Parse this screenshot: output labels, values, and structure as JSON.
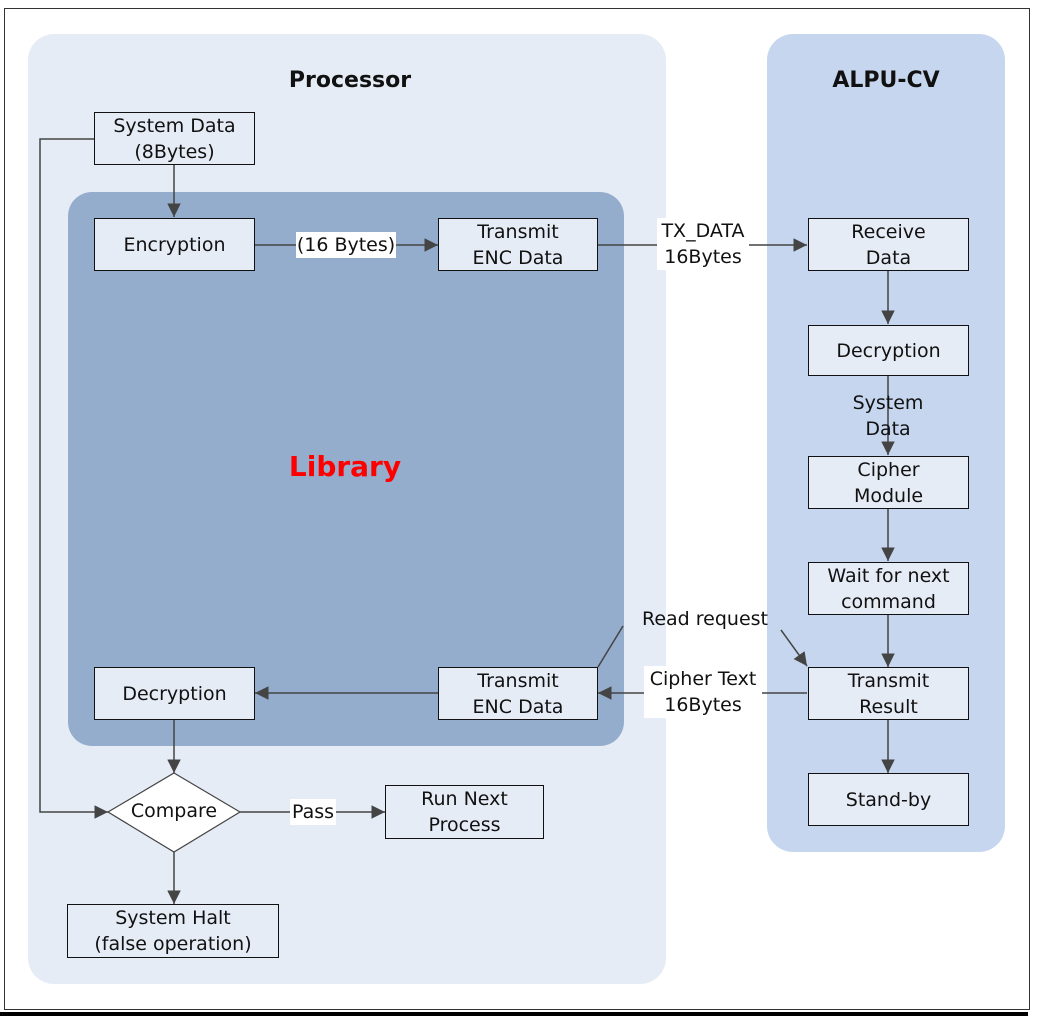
{
  "regions": {
    "processor": "Processor",
    "library": "Library",
    "alpu": "ALPU-CV"
  },
  "colors": {
    "processor_bg": "#e6ecf6",
    "library_bg": "#95adcc",
    "alpu_bg": "#c5d6ee",
    "library_title": "#ff0000",
    "box_fill": "#e6ecf6",
    "line": "#444444"
  },
  "nodes": {
    "system_data": "System Data\n(8Bytes)",
    "encryption": "Encryption",
    "transmit_enc_top": "Transmit\nENC Data",
    "receive_data": "Receive\nData",
    "alpu_decryption": "Decryption",
    "cipher_module": "Cipher\nModule",
    "wait_next": "Wait for next\ncommand",
    "transmit_result": "Transmit\nResult",
    "standby": "Stand-by",
    "transmit_enc_bottom": "Transmit\nENC Data",
    "proc_decryption": "Decryption",
    "compare": "Compare",
    "run_next": "Run Next\nProcess",
    "system_halt": "System Halt\n(false operation)"
  },
  "edge_labels": {
    "sixteen_bytes": "(16 Bytes)",
    "tx_data": "TX_DATA\n16Bytes",
    "system_data": "System\nData",
    "read_request": "Read request",
    "cipher_text": "Cipher Text\n16Bytes",
    "pass": "Pass"
  }
}
